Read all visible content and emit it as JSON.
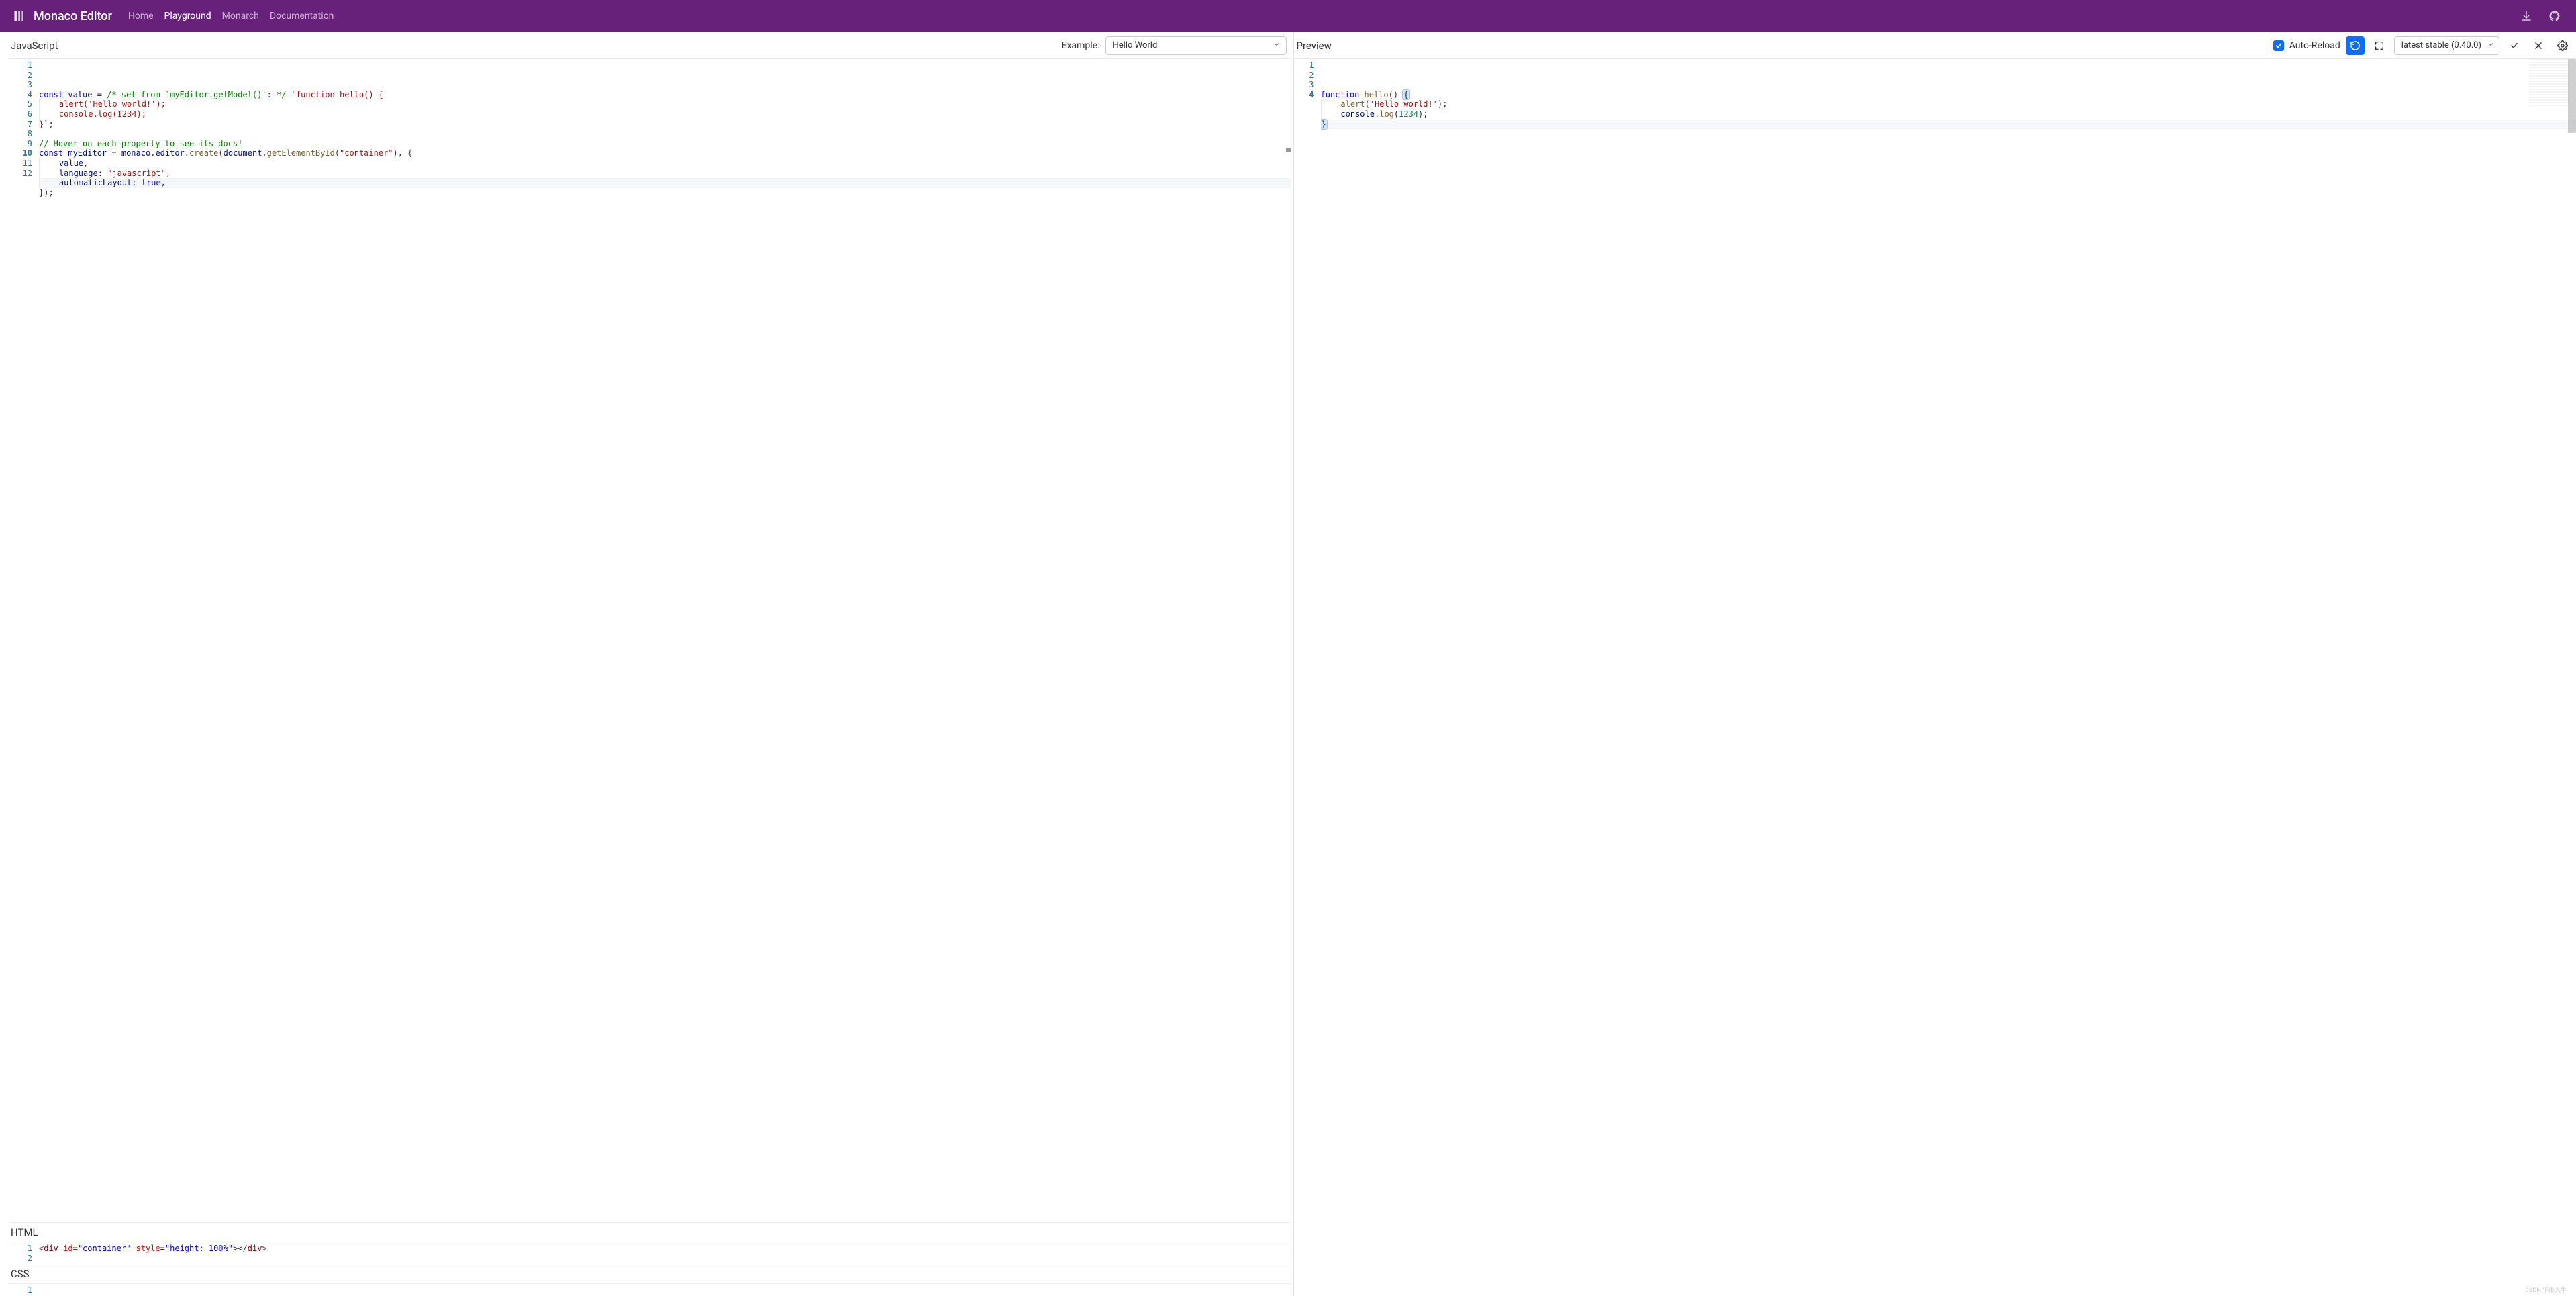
{
  "header": {
    "brand": "Monaco Editor",
    "nav": [
      {
        "label": "Home",
        "active": false
      },
      {
        "label": "Playground",
        "active": true
      },
      {
        "label": "Monarch",
        "active": false
      },
      {
        "label": "Documentation",
        "active": false
      }
    ]
  },
  "left": {
    "title": "JavaScript",
    "example_label": "Example:",
    "example_selected": "Hello World",
    "html_title": "HTML",
    "css_title": "CSS"
  },
  "right": {
    "title": "Preview",
    "auto_reload_label": "Auto-Reload",
    "auto_reload_checked": true,
    "version_selected": "latest stable (0.40.0)"
  },
  "js_editor": {
    "line_count": 12,
    "cursor_line": 10,
    "lines": [
      [
        {
          "t": "const ",
          "c": "kw"
        },
        {
          "t": "value",
          "c": "ident"
        },
        {
          "t": " = ",
          "c": "pun"
        },
        {
          "t": "/* set from `myEditor.getModel()`: */",
          "c": "cmt"
        },
        {
          "t": " ",
          "c": "pun"
        },
        {
          "t": "`function hello() {",
          "c": "tplstr"
        }
      ],
      [
        {
          "t": "    ",
          "c": "pun"
        },
        {
          "t": "alert('Hello world!');",
          "c": "tplstr"
        }
      ],
      [
        {
          "t": "    ",
          "c": "pun"
        },
        {
          "t": "console.log(1234);",
          "c": "tplstr"
        }
      ],
      [
        {
          "t": "}`",
          "c": "tplstr"
        },
        {
          "t": ";",
          "c": "pun"
        }
      ],
      [],
      [
        {
          "t": "// Hover on each property to see its docs!",
          "c": "cmt"
        }
      ],
      [
        {
          "t": "const ",
          "c": "kw"
        },
        {
          "t": "myEditor",
          "c": "ident"
        },
        {
          "t": " = ",
          "c": "pun"
        },
        {
          "t": "monaco",
          "c": "ident"
        },
        {
          "t": ".",
          "c": "pun"
        },
        {
          "t": "editor",
          "c": "ident"
        },
        {
          "t": ".",
          "c": "pun"
        },
        {
          "t": "create",
          "c": "fn"
        },
        {
          "t": "(",
          "c": "pun"
        },
        {
          "t": "document",
          "c": "ident"
        },
        {
          "t": ".",
          "c": "pun"
        },
        {
          "t": "getElementById",
          "c": "fn"
        },
        {
          "t": "(",
          "c": "pun"
        },
        {
          "t": "\"container\"",
          "c": "str"
        },
        {
          "t": "), {",
          "c": "pun"
        }
      ],
      [
        {
          "t": "    ",
          "c": "pun"
        },
        {
          "t": "value",
          "c": "ident"
        },
        {
          "t": ",",
          "c": "pun"
        }
      ],
      [
        {
          "t": "    ",
          "c": "pun"
        },
        {
          "t": "language",
          "c": "ident"
        },
        {
          "t": ": ",
          "c": "pun"
        },
        {
          "t": "\"javascript\"",
          "c": "str"
        },
        {
          "t": ",",
          "c": "pun"
        }
      ],
      [
        {
          "t": "    ",
          "c": "pun"
        },
        {
          "t": "automaticLayout",
          "c": "ident"
        },
        {
          "t": ": ",
          "c": "pun"
        },
        {
          "t": "true",
          "c": "kw"
        },
        {
          "t": ",",
          "c": "pun"
        }
      ],
      [
        {
          "t": "});",
          "c": "pun"
        }
      ],
      []
    ]
  },
  "html_editor": {
    "line_count": 2,
    "lines": [
      [
        {
          "t": "<",
          "c": "pun"
        },
        {
          "t": "div ",
          "c": "tag"
        },
        {
          "t": "id",
          "c": "attr"
        },
        {
          "t": "=",
          "c": "pun"
        },
        {
          "t": "\"container\"",
          "c": "attrval"
        },
        {
          "t": " ",
          "c": "pun"
        },
        {
          "t": "style",
          "c": "attr"
        },
        {
          "t": "=",
          "c": "pun"
        },
        {
          "t": "\"height: 100%\"",
          "c": "attrval"
        },
        {
          "t": "></",
          "c": "pun"
        },
        {
          "t": "div",
          "c": "tag"
        },
        {
          "t": ">",
          "c": "pun"
        }
      ],
      []
    ]
  },
  "css_editor": {
    "line_count": 1,
    "lines": [
      []
    ]
  },
  "preview_editor": {
    "line_count": 4,
    "cursor_line": 4,
    "lines": [
      [
        {
          "t": "function ",
          "c": "kw"
        },
        {
          "t": "hello",
          "c": "fn"
        },
        {
          "t": "() ",
          "c": "pun"
        },
        {
          "t": "{",
          "c": "bracesel"
        }
      ],
      [
        {
          "t": "    ",
          "c": "pun"
        },
        {
          "t": "alert",
          "c": "fn"
        },
        {
          "t": "(",
          "c": "pun"
        },
        {
          "t": "'Hello world!'",
          "c": "str"
        },
        {
          "t": ");",
          "c": "pun"
        }
      ],
      [
        {
          "t": "    ",
          "c": "pun"
        },
        {
          "t": "console",
          "c": "ident"
        },
        {
          "t": ".",
          "c": "pun"
        },
        {
          "t": "log",
          "c": "fn"
        },
        {
          "t": "(",
          "c": "pun"
        },
        {
          "t": "1234",
          "c": "num"
        },
        {
          "t": ");",
          "c": "pun"
        }
      ],
      [
        {
          "t": "}",
          "c": "bracesel"
        }
      ]
    ]
  },
  "watermark": "CSDN 华维大牛"
}
